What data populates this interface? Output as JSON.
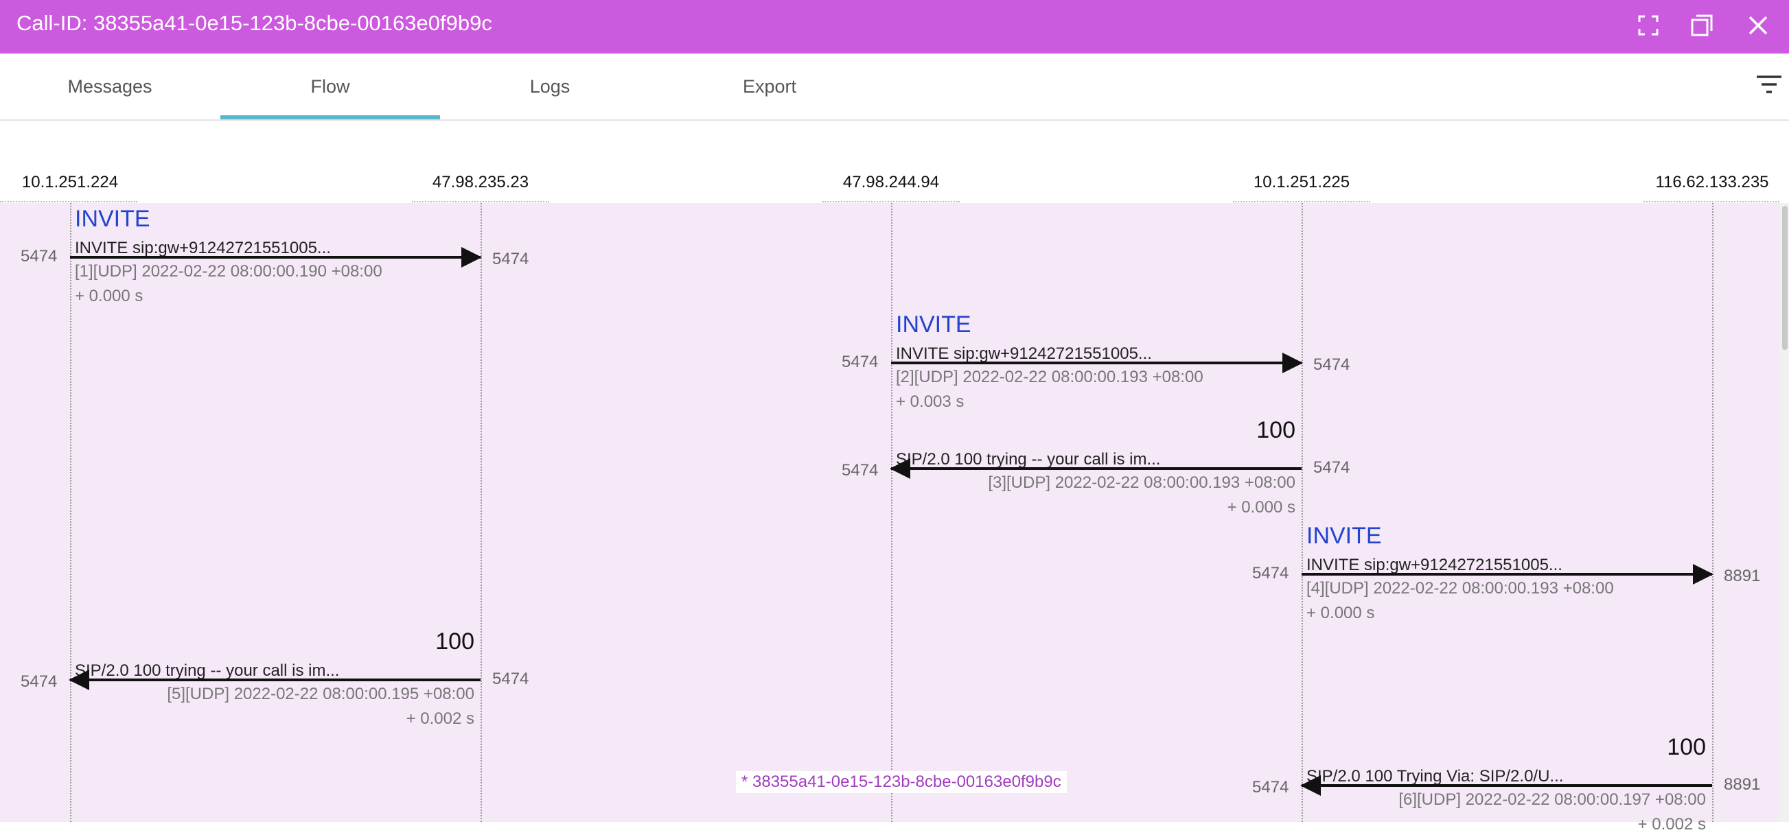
{
  "window": {
    "title": "Call-ID: 38355a41-0e15-123b-8cbe-00163e0f9b9c",
    "controls": [
      "fullscreen-icon",
      "restore-icon",
      "close-icon"
    ]
  },
  "tabs": [
    {
      "label": "Messages",
      "active": false
    },
    {
      "label": "Flow",
      "active": true
    },
    {
      "label": "Logs",
      "active": false
    },
    {
      "label": "Export",
      "active": false
    }
  ],
  "toolbar": {
    "filter_icon": "filter-icon"
  },
  "hosts": [
    "10.1.251.224",
    "47.98.235.23",
    "47.98.244.94",
    "10.1.251.225",
    "116.62.133.235"
  ],
  "messages": [
    {
      "method": "INVITE",
      "text": "INVITE sip:gw+91242721551005...",
      "meta": "[1][UDP] 2022-02-22 08:00:00.190 +08:00",
      "delta": "+ 0.000 s",
      "src_port": "5474",
      "dst_port": "5474",
      "from": "10.1.251.224",
      "to": "47.98.235.23"
    },
    {
      "method": "INVITE",
      "text": "INVITE sip:gw+91242721551005...",
      "meta": "[2][UDP] 2022-02-22 08:00:00.193 +08:00",
      "delta": "+ 0.003 s",
      "src_port": "5474",
      "dst_port": "5474",
      "from": "47.98.244.94",
      "to": "10.1.251.225"
    },
    {
      "method": "100",
      "text": "SIP/2.0 100 trying -- your call is im...",
      "meta": "[3][UDP] 2022-02-22 08:00:00.193 +08:00",
      "delta": "+ 0.000 s",
      "src_port": "5474",
      "dst_port": "5474",
      "from": "10.1.251.225",
      "to": "47.98.244.94"
    },
    {
      "method": "INVITE",
      "text": "INVITE sip:gw+91242721551005...",
      "meta": "[4][UDP] 2022-02-22 08:00:00.193 +08:00",
      "delta": "+ 0.000 s",
      "src_port": "5474",
      "dst_port": "8891",
      "from": "10.1.251.225",
      "to": "116.62.133.235"
    },
    {
      "method": "100",
      "text": "SIP/2.0 100 trying -- your call is im...",
      "meta": "[5][UDP] 2022-02-22 08:00:00.195 +08:00",
      "delta": "+ 0.002 s",
      "src_port": "5474",
      "dst_port": "5474",
      "from": "47.98.235.23",
      "to": "10.1.251.224"
    },
    {
      "method": "100",
      "text": "SIP/2.0 100 Trying Via: SIP/2.0/U...",
      "meta": "[6][UDP] 2022-02-22 08:00:00.197 +08:00",
      "delta": "+ 0.002 s",
      "src_port": "8891",
      "dst_port": "5474",
      "from": "116.62.133.235",
      "to": "10.1.251.225"
    }
  ],
  "watermark": "* 38355a41-0e15-123b-8cbe-00163e0f9b9c",
  "colors": {
    "titlebar": "#cc5ade",
    "flow_bg": "#f5e8f7",
    "method": "#2244cc",
    "tab_indicator": "#5bb8cc",
    "watermark": "#a23cc0"
  }
}
